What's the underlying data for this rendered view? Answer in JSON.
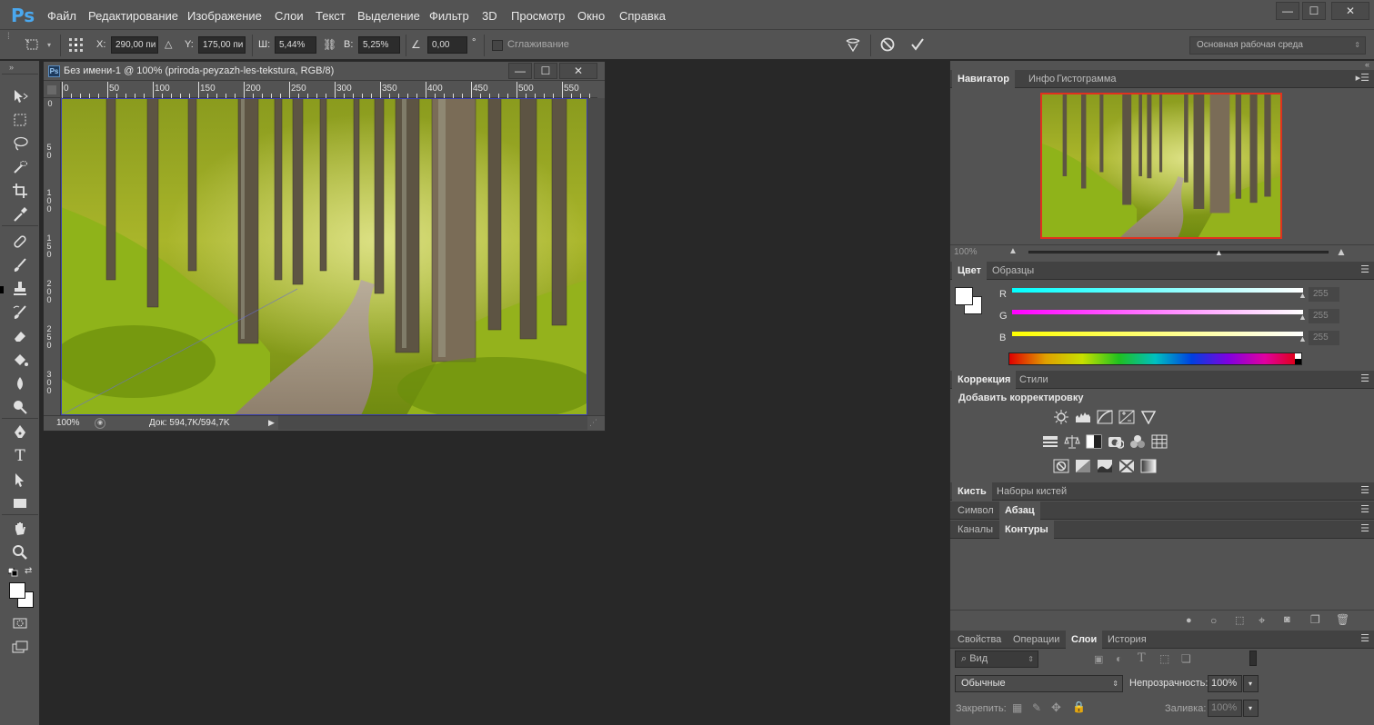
{
  "app": {
    "logo": "Ps"
  },
  "menu": {
    "items": [
      "Файл",
      "Редактирование",
      "Изображение",
      "Слои",
      "Текст",
      "Выделение",
      "Фильтр",
      "3D",
      "Просмотр",
      "Окно",
      "Справка"
    ]
  },
  "window_controls": {
    "minimize": "—",
    "maximize": "☐",
    "close": "✕"
  },
  "options": {
    "x_label": "X:",
    "x_value": "290,00 пи",
    "y_label": "Y:",
    "y_value": "175,00 пи",
    "w_label": "Ш:",
    "w_value": "5,44%",
    "h_label": "В:",
    "h_value": "5,25%",
    "angle_value": "0,00",
    "angle_unit": "°",
    "smoothing_label": "Сглаживание",
    "workspace": "Основная рабочая среда"
  },
  "document": {
    "title": "Без имени-1 @ 100% (priroda-peyzazh-les-tekstura, RGB/8)",
    "ps_badge": "Ps",
    "ruler_h": [
      "0",
      "50",
      "100",
      "150",
      "200",
      "250",
      "300",
      "350",
      "400",
      "450",
      "500",
      "550"
    ],
    "ruler_v": [
      "0",
      "5 0",
      "1 0 0",
      "1 5 0",
      "2 0 0",
      "2 5 0",
      "3 0 0"
    ],
    "zoom": "100%",
    "doc_info": "Док: 594,7K/594,7K"
  },
  "navigator": {
    "tabs": [
      "Навигатор",
      "Инфо",
      "Гистограмма"
    ],
    "zoom": "100%",
    "zoom_level": 0.63
  },
  "color": {
    "tabs": [
      "Цвет",
      "Образцы"
    ],
    "channels": [
      {
        "label": "R",
        "value": "255"
      },
      {
        "label": "G",
        "value": "255"
      },
      {
        "label": "B",
        "value": "255"
      }
    ]
  },
  "correction": {
    "tabs": [
      "Коррекция",
      "Стили"
    ],
    "title": "Добавить корректировку"
  },
  "brush": {
    "tabs": [
      "Кисть",
      "Наборы кистей"
    ]
  },
  "symbol": {
    "tabs": [
      "Символ",
      "Абзац"
    ]
  },
  "channels": {
    "tabs": [
      "Каналы",
      "Контуры"
    ]
  },
  "layers": {
    "tabs": [
      "Свойства",
      "Операции",
      "Слои",
      "История"
    ],
    "filter_placeholder": "Вид",
    "blend_mode": "Обычные",
    "opacity_label": "Непрозрачность:",
    "opacity_value": "100%",
    "lock_label": "Закрепить:",
    "fill_label": "Заливка:",
    "fill_value": "100%"
  },
  "colors": {
    "accent_blue": "#4aa8ef",
    "panel_bg": "#535353",
    "workspace_bg": "#282828"
  }
}
